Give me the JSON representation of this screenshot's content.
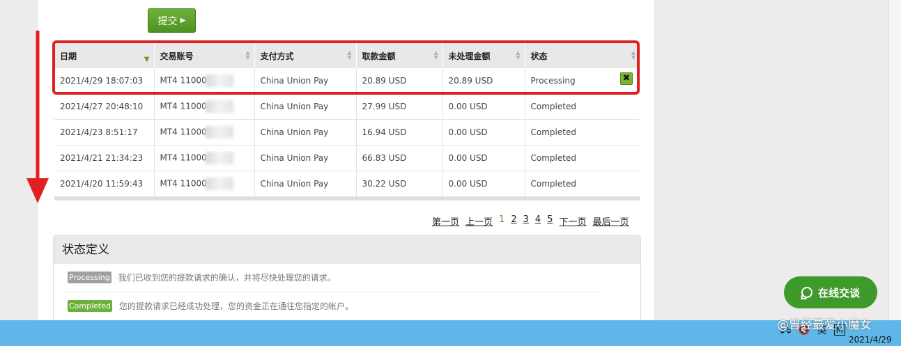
{
  "submit": {
    "label": "提交",
    "icon": "play-triangle-icon"
  },
  "table": {
    "headers": [
      "日期",
      "交易账号",
      "支付方式",
      "取款金额",
      "未处理金额",
      "状态"
    ],
    "rows": [
      {
        "date": "2021/4/29 18:07:03",
        "account": "MT4 11000",
        "method": "China Union Pay",
        "amount": "20.89 USD",
        "pending": "20.89 USD",
        "status": "Processing"
      },
      {
        "date": "2021/4/27 20:48:10",
        "account": "MT4 11000",
        "method": "China Union Pay",
        "amount": "27.99 USD",
        "pending": "0.00 USD",
        "status": "Completed"
      },
      {
        "date": "2021/4/23 8:51:17",
        "account": "MT4 11000",
        "method": "China Union Pay",
        "amount": "16.94 USD",
        "pending": "0.00 USD",
        "status": "Completed"
      },
      {
        "date": "2021/4/21 21:34:23",
        "account": "MT4 11000",
        "method": "China Union Pay",
        "amount": "66.83 USD",
        "pending": "0.00 USD",
        "status": "Completed"
      },
      {
        "date": "2021/4/20 11:59:43",
        "account": "MT4 11000",
        "method": "China Union Pay",
        "amount": "30.22 USD",
        "pending": "0.00 USD",
        "status": "Completed"
      }
    ]
  },
  "pagination": {
    "first": "第一页",
    "prev": "上一页",
    "pages": [
      "1",
      "2",
      "3",
      "4",
      "5"
    ],
    "current": "1",
    "next": "下一页",
    "last": "最后一页"
  },
  "status_def": {
    "title": "状态定义",
    "items": [
      {
        "badge": "Processing",
        "text": "我们已收到您的提款请求的确认，并将尽快处理您的请求。"
      },
      {
        "badge": "Completed",
        "text": "您的提款请求已经成功处理，您的资金正在通往您指定的帐户。"
      }
    ]
  },
  "chat": {
    "label": "在线交谈"
  },
  "watermark": "@曾经最爱小魔女",
  "taskbar": {
    "ime": "英",
    "m_icon": "M",
    "date": "2021/4/29"
  },
  "colors": {
    "accent_green": "#4e9222",
    "highlight_red": "#e02020",
    "taskbar_blue": "#5fb6e8"
  }
}
